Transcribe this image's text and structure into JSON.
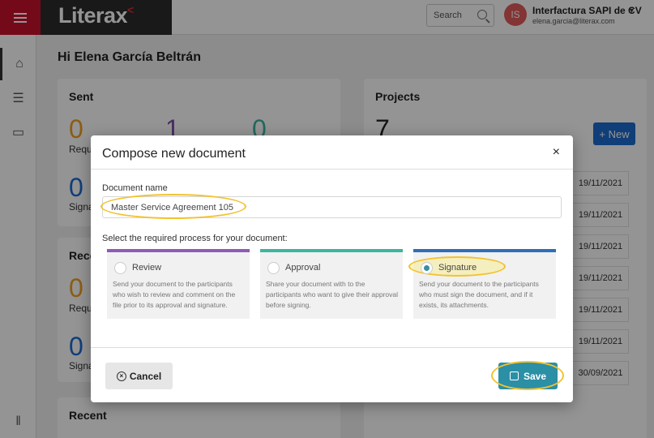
{
  "header": {
    "brand": "Literax",
    "search_label": "Search",
    "avatar_initials": "IS",
    "account_name": "Interfactura SAPI de CV",
    "account_email": "elena.garcia@literax.com"
  },
  "dashboard": {
    "greeting": "Hi Elena García Beltrán",
    "sent_title": "Sent",
    "sent_values": [
      "0",
      "1",
      "0"
    ],
    "sent_label_1": "Requ",
    "sent_value_2": "0",
    "sent_label_2": "Signa",
    "received_title": "Rece",
    "received_value_1": "0",
    "received_label_1": "Requ",
    "received_value_2": "0",
    "received_label_2": "Signa",
    "recent_title": "Recent",
    "projects_title": "Projects",
    "projects_count": "7",
    "new_button": "+ New",
    "dates": [
      "19/11/2021",
      "19/11/2021",
      "19/11/2021",
      "19/11/2021",
      "19/11/2021",
      "19/11/2021",
      "30/09/2021"
    ]
  },
  "modal": {
    "title": "Compose new document",
    "close": "×",
    "document_name_label": "Document name",
    "document_name_value": "Master Service Agreement 105",
    "process_label": "Select the required process for your document:",
    "processes": [
      {
        "name": "Review",
        "color": "#8e5bb5",
        "description": "Send your document to the participants who wish to review and comment on the file prior to its approval and signature."
      },
      {
        "name": "Approval",
        "color": "#3cb59e",
        "description": "Share your document with to the participants who want to give their approval before signing."
      },
      {
        "name": "Signature",
        "color": "#2f6fb5",
        "description": "Send your document to the participants who must sign the document, and if it exists, its attachments."
      }
    ],
    "selected_process": "Signature",
    "cancel_label": "Cancel",
    "save_label": "Save"
  }
}
